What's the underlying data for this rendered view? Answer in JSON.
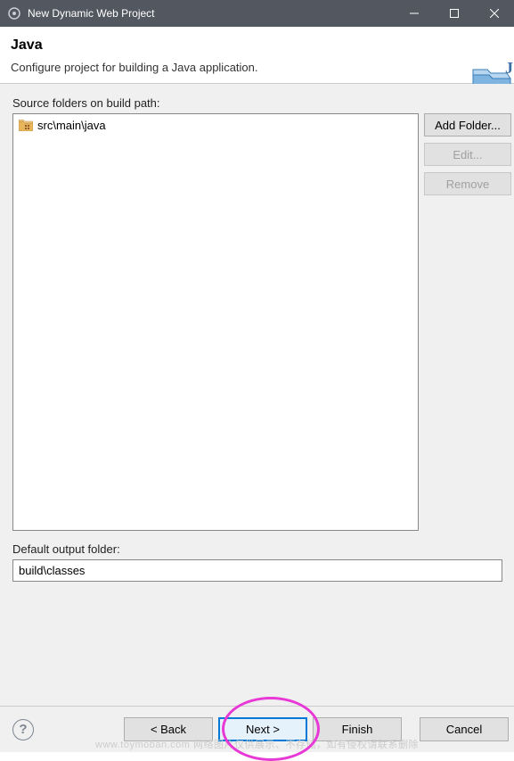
{
  "titlebar": {
    "title": "New Dynamic Web Project"
  },
  "banner": {
    "title": "Java",
    "description": "Configure project for building a Java application."
  },
  "source": {
    "label": "Source folders on build path:",
    "items": [
      "src\\main\\java"
    ],
    "buttons": {
      "add": "Add Folder...",
      "edit": "Edit...",
      "remove": "Remove"
    }
  },
  "output": {
    "label": "Default output folder:",
    "value": "build\\classes"
  },
  "footer": {
    "help": "?",
    "back": "< Back",
    "next": "Next >",
    "finish": "Finish",
    "cancel": "Cancel"
  },
  "watermark": "www.toymoban.com 网络图片仅供展示、不存储，如有侵权请联系删除"
}
